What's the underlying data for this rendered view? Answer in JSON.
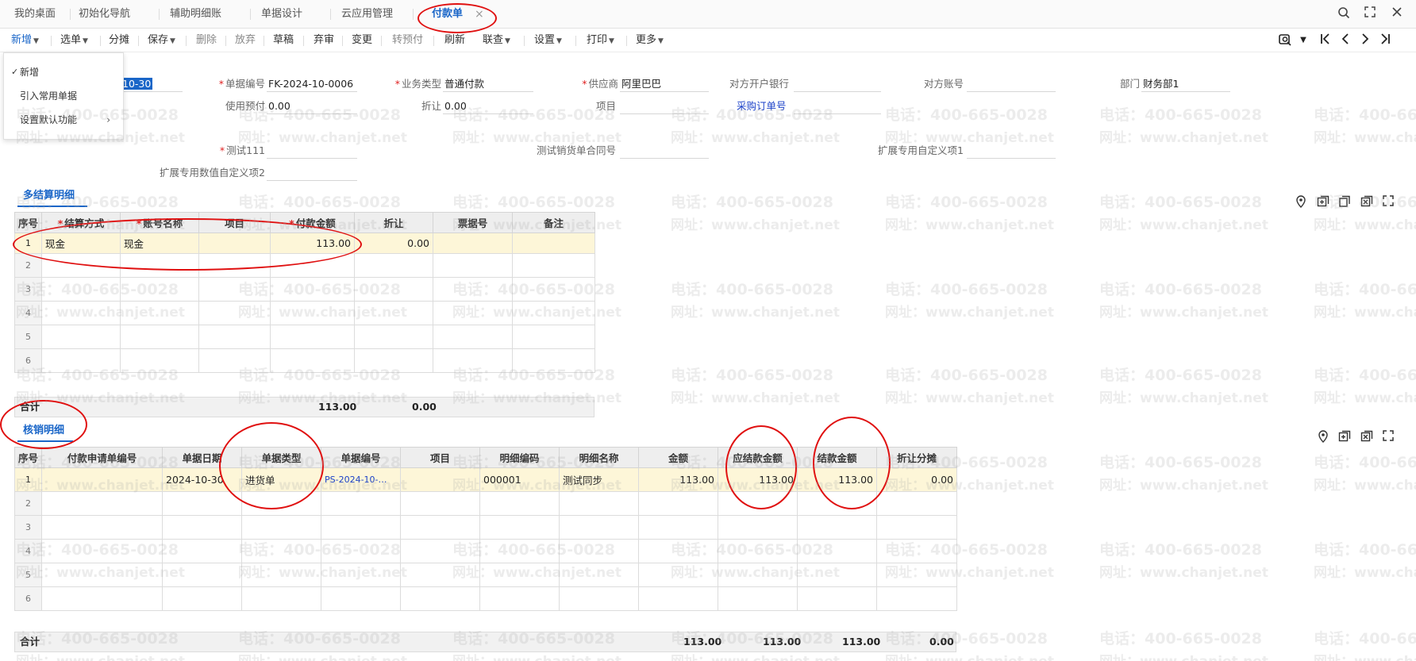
{
  "tabs": [
    {
      "label": "我的桌面"
    },
    {
      "label": "初始化导航"
    },
    {
      "label": "辅助明细账"
    },
    {
      "label": "单据设计"
    },
    {
      "label": "云应用管理"
    },
    {
      "label": "付款单"
    }
  ],
  "tab_close": "×",
  "toolbar": {
    "new": "新增",
    "select": "选单",
    "split": "分摊",
    "save": "保存",
    "delete": "删除",
    "discard": "放弃",
    "draft": "草稿",
    "abandon": "弃审",
    "change": "变更",
    "to_prepay": "转预付",
    "refresh": "刷新",
    "linked": "联查",
    "settings": "设置",
    "print": "打印",
    "more": "更多"
  },
  "dropdown": {
    "check": "✓",
    "items": [
      "新增",
      "引入常用单据",
      "设置默认功能"
    ]
  },
  "form": {
    "date_value": "10-30",
    "doc_no_label": "单据编号",
    "doc_no": "FK-2024-10-0006",
    "biz_type_label": "业务类型",
    "biz_type": "普通付款",
    "supplier_label": "供应商",
    "supplier": "阿里巴巴",
    "bank_label": "对方开户银行",
    "bank": "",
    "account_label": "对方账号",
    "account": "",
    "dept_label": "部门",
    "dept": "财务部1",
    "prepay_label": "使用预付",
    "prepay": "0.00",
    "discount_label": "折让",
    "discount": "0.00",
    "project_label": "项目",
    "project": "",
    "po_link": "采购订单号",
    "test_label": "测试111",
    "contract_label": "测试销货单合同号",
    "ext1_label": "扩展专用自定义项1",
    "ext2_label": "扩展专用数值自定义项2"
  },
  "settle": {
    "title": "多结算明细",
    "headers": [
      "序号",
      "结算方式",
      "账号名称",
      "项目",
      "付款金额",
      "折让",
      "票据号",
      "备注"
    ],
    "rows": [
      [
        "1",
        "现金",
        "现金",
        "",
        "113.00",
        "0.00",
        "",
        ""
      ],
      [
        "2",
        "",
        "",
        "",
        "",
        "",
        "",
        ""
      ],
      [
        "3",
        "",
        "",
        "",
        "",
        "",
        "",
        ""
      ],
      [
        "4",
        "",
        "",
        "",
        "",
        "",
        "",
        ""
      ],
      [
        "5",
        "",
        "",
        "",
        "",
        "",
        "",
        ""
      ],
      [
        "6",
        "",
        "",
        "",
        "",
        "",
        "",
        ""
      ]
    ],
    "sum_label": "合计",
    "sum_amount": "113.00",
    "sum_discount": "0.00"
  },
  "verify": {
    "title": "核销明细",
    "headers": [
      "序号",
      "付款申请单编号",
      "单据日期",
      "单据类型",
      "单据编号",
      "项目",
      "明细编码",
      "明细名称",
      "金额",
      "应结款金额",
      "结款金额",
      "折让分摊"
    ],
    "rows": [
      [
        "1",
        "",
        "2024-10-30",
        "进货单",
        "PS-2024-10-…",
        "",
        "000001",
        "测试同步",
        "113.00",
        "113.00",
        "113.00",
        "0.00"
      ],
      [
        "2",
        "",
        "",
        "",
        "",
        "",
        "",
        "",
        "",
        "",
        "",
        ""
      ],
      [
        "3",
        "",
        "",
        "",
        "",
        "",
        "",
        "",
        "",
        "",
        "",
        ""
      ],
      [
        "4",
        "",
        "",
        "",
        "",
        "",
        "",
        "",
        "",
        "",
        "",
        ""
      ],
      [
        "5",
        "",
        "",
        "",
        "",
        "",
        "",
        "",
        "",
        "",
        "",
        ""
      ],
      [
        "6",
        "",
        "",
        "",
        "",
        "",
        "",
        "",
        "",
        "",
        "",
        ""
      ]
    ],
    "sum_label": "合计",
    "sum_amount": "113.00",
    "sum_due": "113.00",
    "sum_paid": "113.00",
    "sum_share": "0.00"
  },
  "watermark": {
    "phone": "电话：400-665-0028",
    "site": "网址：www.chanjet.net"
  }
}
